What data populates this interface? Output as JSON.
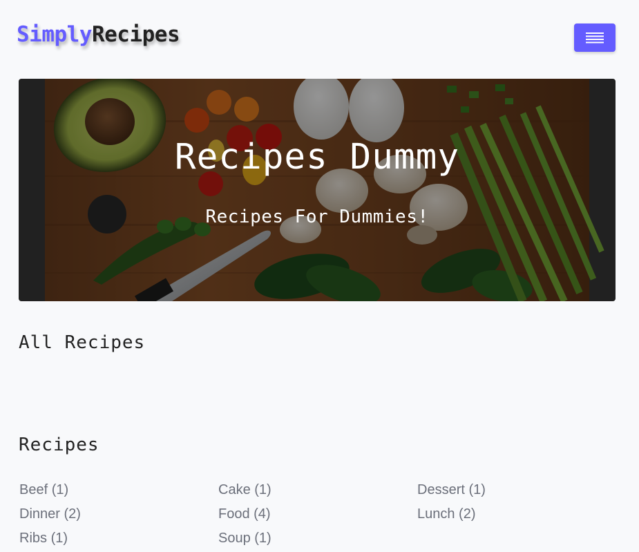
{
  "navbar": {
    "logo_part_1": "Simply",
    "logo_part_2": "Recipes",
    "menu_icon": "hamburger-menu-icon",
    "accent_color": "#645cff"
  },
  "hero": {
    "title": "Recipes Dummy",
    "subtitle": "Recipes For Dummies!"
  },
  "main": {
    "all_recipes_title": "All Recipes",
    "recipes_title": "Recipes",
    "tags": [
      "Beef (1)",
      "Cake (1)",
      "Dessert (1)",
      "Dinner (2)",
      "Food (4)",
      "Lunch (2)",
      "Ribs (1)",
      "Soup (1)"
    ]
  }
}
